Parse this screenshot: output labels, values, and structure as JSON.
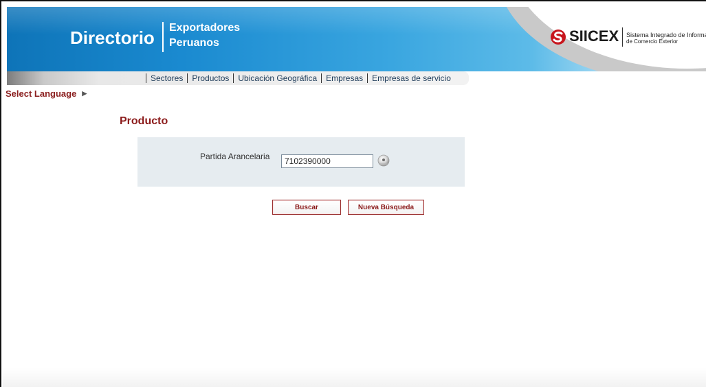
{
  "header": {
    "brand_title": "Directorio",
    "brand_subtitle_line1": "Exportadores",
    "brand_subtitle_line2": "Peruanos",
    "siicex_name": "SIICEX",
    "siicex_desc_line1": "Sistema Integrado de Información",
    "siicex_desc_line2": "de Comercio Exterior"
  },
  "nav": {
    "items": [
      {
        "label": "Sectores"
      },
      {
        "label": "Productos"
      },
      {
        "label": "Ubicación Geográfica"
      },
      {
        "label": "Empresas"
      },
      {
        "label": "Empresas de servicio"
      }
    ]
  },
  "language": {
    "label": "Select Language"
  },
  "main": {
    "title": "Producto",
    "field_label": "Partida Arancelaria",
    "field_value": "7102390000",
    "buttons": {
      "search": "Buscar",
      "new_search": "Nueva Búsqueda"
    }
  },
  "colors": {
    "banner_blue": "#1a8ad0",
    "title_red": "#8b1a1a",
    "form_bg": "#e6ecf0"
  }
}
